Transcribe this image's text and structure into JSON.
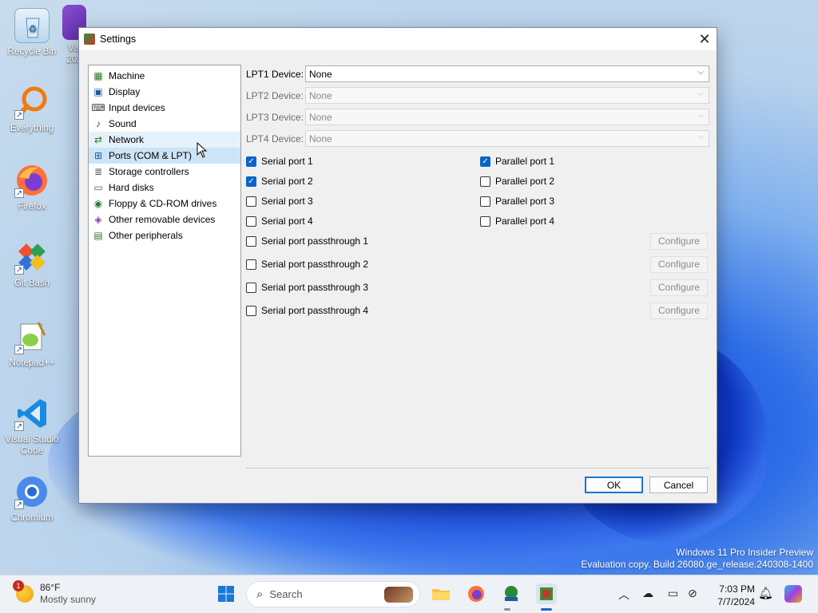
{
  "desktop": {
    "icons": [
      {
        "label": "Recycle Bin"
      },
      {
        "label": "Everything"
      },
      {
        "label": "Firefox"
      },
      {
        "label": "Git Bash"
      },
      {
        "label": "Notepad++"
      },
      {
        "label": "Visual Studio Code"
      },
      {
        "label": "Chromium"
      },
      {
        "label": "Vis 202"
      }
    ],
    "watermark_line1": "Windows 11 Pro Insider Preview",
    "watermark_line2": "Evaluation copy. Build 26080.ge_release.240308-1400"
  },
  "window": {
    "title": "Settings",
    "close_glyph": "✕"
  },
  "sidebar": {
    "items": [
      {
        "label": "Machine",
        "icon": "machine-icon"
      },
      {
        "label": "Display",
        "icon": "display-icon"
      },
      {
        "label": "Input devices",
        "icon": "input-devices-icon"
      },
      {
        "label": "Sound",
        "icon": "sound-icon"
      },
      {
        "label": "Network",
        "icon": "network-icon"
      },
      {
        "label": "Ports (COM & LPT)",
        "icon": "ports-icon"
      },
      {
        "label": "Storage controllers",
        "icon": "storage-icon"
      },
      {
        "label": "Hard disks",
        "icon": "hard-disk-icon"
      },
      {
        "label": "Floppy & CD-ROM drives",
        "icon": "floppy-cdrom-icon"
      },
      {
        "label": "Other removable devices",
        "icon": "removable-icon"
      },
      {
        "label": "Other peripherals",
        "icon": "peripherals-icon"
      }
    ],
    "selected": "Ports (COM & LPT)",
    "hovered": "Network"
  },
  "ports": {
    "lpt": [
      {
        "label": "LPT1 Device:",
        "value": "None",
        "enabled": true
      },
      {
        "label": "LPT2 Device:",
        "value": "None",
        "enabled": false
      },
      {
        "label": "LPT3 Device:",
        "value": "None",
        "enabled": false
      },
      {
        "label": "LPT4 Device:",
        "value": "None",
        "enabled": false
      }
    ],
    "serial": [
      {
        "label": "Serial port 1",
        "checked": true
      },
      {
        "label": "Serial port 2",
        "checked": true
      },
      {
        "label": "Serial port 3",
        "checked": false
      },
      {
        "label": "Serial port 4",
        "checked": false
      }
    ],
    "parallel": [
      {
        "label": "Parallel port 1",
        "checked": true
      },
      {
        "label": "Parallel port 2",
        "checked": false
      },
      {
        "label": "Parallel port 3",
        "checked": false
      },
      {
        "label": "Parallel port 4",
        "checked": false
      }
    ],
    "passthrough": [
      {
        "label": "Serial port passthrough 1",
        "checked": false,
        "button": "Configure"
      },
      {
        "label": "Serial port passthrough 2",
        "checked": false,
        "button": "Configure"
      },
      {
        "label": "Serial port passthrough 3",
        "checked": false,
        "button": "Configure"
      },
      {
        "label": "Serial port passthrough 4",
        "checked": false,
        "button": "Configure"
      }
    ]
  },
  "buttons": {
    "ok": "OK",
    "cancel": "Cancel"
  },
  "taskbar": {
    "weather_temp": "86°F",
    "weather_desc": "Mostly sunny",
    "weather_badge": "1",
    "search_placeholder": "Search",
    "time": "7:03 PM",
    "date": "7/7/2024",
    "apps": [
      "start-icon",
      "search-icon",
      "file-explorer-icon",
      "firefox-icon",
      "network-app-icon",
      "emulator-app-icon"
    ]
  },
  "colors": {
    "accent": "#0a64c8",
    "selection": "#cce4f7",
    "hover": "#e5f1fb"
  }
}
